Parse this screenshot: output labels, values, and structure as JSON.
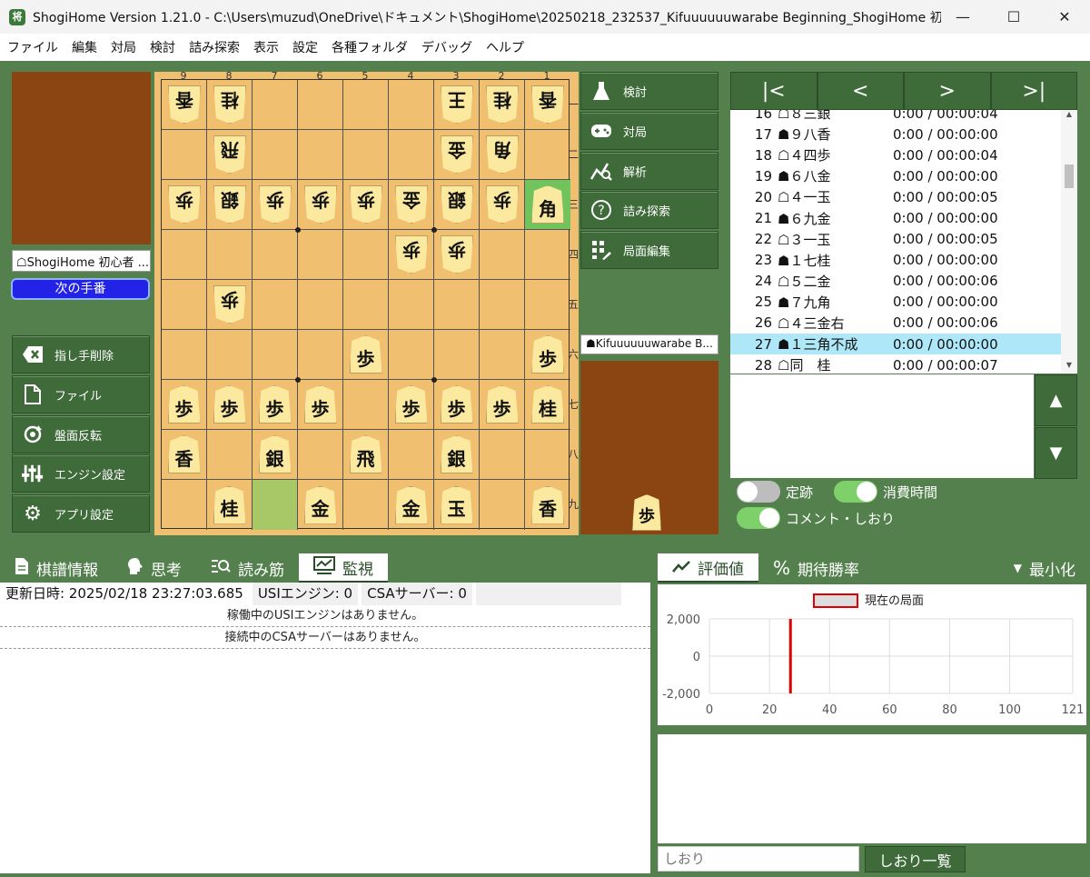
{
  "window": {
    "title": "ShogiHome Version 1.21.0 - C:\\Users\\muzud\\OneDrive\\ドキュメント\\ShogiHome\\20250218_232537_Kifuuuuuuwarabe Beginning_ShogiHome 初心者 (居飛...",
    "app_icon": "将",
    "minimize": "—",
    "maximize": "☐",
    "close": "✕"
  },
  "menu": [
    "ファイル",
    "編集",
    "対局",
    "検討",
    "詰み探索",
    "表示",
    "設定",
    "各種フォルダ",
    "デバッグ",
    "ヘルプ"
  ],
  "players": {
    "gote_label": "☖ShogiHome 初心者 ...",
    "sente_label": "☗Kifuuuuuuwarabe B...",
    "turn_badge": "次の手番"
  },
  "left_buttons": [
    {
      "icon": "backspace-icon",
      "label": "指し手削除"
    },
    {
      "icon": "file-icon",
      "label": "ファイル"
    },
    {
      "icon": "flip-icon",
      "label": "盤面反転"
    },
    {
      "icon": "engine-icon",
      "label": "エンジン設定"
    },
    {
      "icon": "gear-icon",
      "label": "アプリ設定"
    }
  ],
  "right_buttons": [
    {
      "icon": "flask-icon",
      "label": "検討"
    },
    {
      "icon": "gamepad-icon",
      "label": "対局"
    },
    {
      "icon": "analysis-icon",
      "label": "解析"
    },
    {
      "icon": "question-icon",
      "label": "詰み探索"
    },
    {
      "icon": "grid-icon",
      "label": "局面編集"
    }
  ],
  "board": {
    "file_labels": [
      "9",
      "8",
      "7",
      "6",
      "5",
      "4",
      "3",
      "2",
      "1"
    ],
    "rank_labels": [
      "一",
      "二",
      "三",
      "四",
      "五",
      "六",
      "七",
      "八",
      "九"
    ],
    "rows": [
      [
        {
          "p": "香",
          "g": 1
        },
        {
          "p": "桂",
          "g": 1
        },
        null,
        null,
        null,
        null,
        {
          "p": "王",
          "g": 1
        },
        {
          "p": "桂",
          "g": 1
        },
        {
          "p": "香",
          "g": 1
        }
      ],
      [
        null,
        {
          "p": "飛",
          "g": 1
        },
        null,
        null,
        null,
        null,
        {
          "p": "金",
          "g": 1
        },
        {
          "p": "角",
          "g": 1
        },
        null
      ],
      [
        {
          "p": "歩",
          "g": 1
        },
        {
          "p": "銀",
          "g": 1
        },
        {
          "p": "歩",
          "g": 1
        },
        {
          "p": "歩",
          "g": 1
        },
        {
          "p": "歩",
          "g": 1
        },
        {
          "p": "金",
          "g": 1
        },
        {
          "p": "銀",
          "g": 1
        },
        {
          "p": "歩",
          "g": 1
        },
        {
          "p": "角",
          "g": 0,
          "sel": 1
        }
      ],
      [
        null,
        null,
        null,
        null,
        null,
        {
          "p": "歩",
          "g": 1
        },
        {
          "p": "歩",
          "g": 1
        },
        null,
        null
      ],
      [
        null,
        {
          "p": "歩",
          "g": 1
        },
        null,
        null,
        null,
        null,
        null,
        null,
        null
      ],
      [
        null,
        null,
        null,
        null,
        {
          "p": "歩",
          "g": 0
        },
        null,
        null,
        null,
        {
          "p": "歩",
          "g": 0
        }
      ],
      [
        {
          "p": "歩",
          "g": 0
        },
        {
          "p": "歩",
          "g": 0
        },
        {
          "p": "歩",
          "g": 0
        },
        {
          "p": "歩",
          "g": 0
        },
        null,
        {
          "p": "歩",
          "g": 0
        },
        {
          "p": "歩",
          "g": 0
        },
        {
          "p": "歩",
          "g": 0
        },
        {
          "p": "桂",
          "g": 0
        }
      ],
      [
        {
          "p": "香",
          "g": 0
        },
        null,
        {
          "p": "銀",
          "g": 0
        },
        null,
        {
          "p": "飛",
          "g": 0
        },
        null,
        {
          "p": "銀",
          "g": 0
        },
        null,
        null
      ],
      [
        null,
        {
          "p": "桂",
          "g": 0
        },
        {
          "hl": 1
        },
        {
          "p": "金",
          "g": 0
        },
        null,
        {
          "p": "金",
          "g": 0
        },
        {
          "p": "玉",
          "g": 0
        },
        null,
        {
          "p": "香",
          "g": 0
        }
      ]
    ],
    "sente_hand": [
      "歩"
    ]
  },
  "record": {
    "nav": [
      "|<",
      "<",
      ">",
      ">|"
    ],
    "moves": [
      {
        "n": "16",
        "m": "☖８三銀",
        "t": "0:00 / 00:00:04"
      },
      {
        "n": "17",
        "m": "☗９八香",
        "t": "0:00 / 00:00:00"
      },
      {
        "n": "18",
        "m": "☖４四歩",
        "t": "0:00 / 00:00:04"
      },
      {
        "n": "19",
        "m": "☗６八金",
        "t": "0:00 / 00:00:00"
      },
      {
        "n": "20",
        "m": "☖４一玉",
        "t": "0:00 / 00:00:05"
      },
      {
        "n": "21",
        "m": "☗６九金",
        "t": "0:00 / 00:00:00"
      },
      {
        "n": "22",
        "m": "☖３一玉",
        "t": "0:00 / 00:00:05"
      },
      {
        "n": "23",
        "m": "☗１七桂",
        "t": "0:00 / 00:00:00"
      },
      {
        "n": "24",
        "m": "☖５二金",
        "t": "0:00 / 00:00:06"
      },
      {
        "n": "25",
        "m": "☗７九角",
        "t": "0:00 / 00:00:00"
      },
      {
        "n": "26",
        "m": "☖４三金右",
        "t": "0:00 / 00:00:06"
      },
      {
        "n": "27",
        "m": "☗１三角不成",
        "t": "0:00 / 00:00:00",
        "current": true
      },
      {
        "n": "28",
        "m": "☖同　桂",
        "t": "0:00 / 00:00:07"
      }
    ]
  },
  "toggles": {
    "joseki": "定跡",
    "elapsed": "消費時間",
    "comment": "コメント・しおり"
  },
  "bottom_tabs_left": [
    {
      "icon": "document-icon",
      "label": "棋譜情報"
    },
    {
      "icon": "brain-icon",
      "label": "思考"
    },
    {
      "icon": "search-list-icon",
      "label": "読み筋"
    },
    {
      "icon": "monitor-icon",
      "label": "監視",
      "active": true
    }
  ],
  "monitor": {
    "updated": "更新日時: 2025/02/18 23:27:03.685",
    "usi": "USIエンジン: 0",
    "csa": "CSAサーバー: 0",
    "usi_msg": "稼働中のUSIエンジンはありません。",
    "csa_msg": "接続中のCSAサーバーはありません。"
  },
  "bottom_tabs_right": [
    {
      "icon": "line-chart-icon",
      "label": "評価値",
      "active": true
    },
    {
      "icon": "percent-icon",
      "label": "期待勝率"
    },
    {
      "icon": "triangle-down-icon",
      "label": "最小化"
    }
  ],
  "chart_data": {
    "type": "line",
    "legend": [
      "現在の局面"
    ],
    "x_ticks": [
      "0",
      "20",
      "40",
      "60",
      "80",
      "100",
      "121"
    ],
    "y_ticks": [
      "2,000",
      "0",
      "-2,000"
    ],
    "xlim": [
      0,
      121
    ],
    "ylim": [
      -2000,
      2000
    ],
    "current_position_x": 27,
    "series": []
  },
  "bookmark": {
    "placeholder": "しおり",
    "button": "しおり一覧"
  },
  "colors": {
    "panel_green": "#54804e",
    "button_green": "#3f6a3a",
    "board": "#f0c070",
    "hand": "#8b4513",
    "turn_blue": "#2323e8",
    "current_move": "#aee8f8",
    "marker_red": "#e00000"
  }
}
